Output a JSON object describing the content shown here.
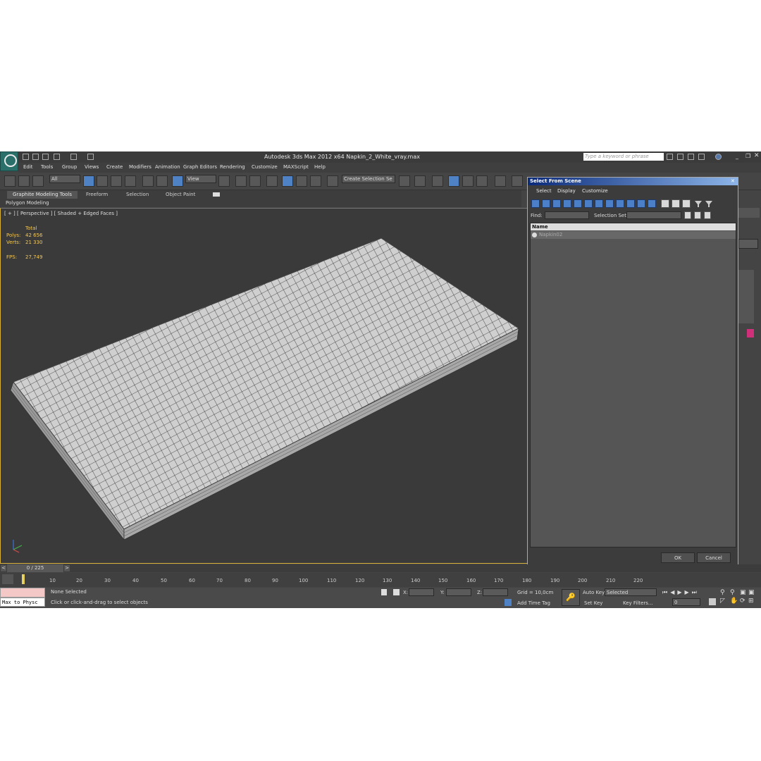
{
  "title": "Autodesk 3ds Max  2012 x64     Napkin_2_White_vray.max",
  "search_placeholder": "Type a keyword or phrase",
  "menu": [
    "Edit",
    "Tools",
    "Group",
    "Views",
    "Create",
    "Modifiers",
    "Animation",
    "Graph Editors",
    "Rendering",
    "Customize",
    "MAXScript",
    "Help"
  ],
  "toolbar": {
    "filter_combo": "All",
    "refcoord_combo": "View",
    "named_selection": "Create Selection Se"
  },
  "ribbon_tabs": [
    "Graphite Modeling Tools",
    "Freeform",
    "Selection",
    "Object Paint"
  ],
  "ribbon_sub": "Polygon Modeling",
  "viewport": {
    "label": "[ + ] [ Perspective ] [ Shaded + Edged Faces ]",
    "stats_header": "Total",
    "polys_label": "Polys:",
    "polys_value": "42 656",
    "verts_label": "Verts:",
    "verts_value": "21 330",
    "fps_label": "FPS:",
    "fps_value": "27,749"
  },
  "dialog": {
    "title": "Select From Scene",
    "menu": [
      "Select",
      "Display",
      "Customize"
    ],
    "find_label": "Find:",
    "selection_set_label": "Selection Set:",
    "column_name": "Name",
    "items": [
      "Napkin02"
    ],
    "ok": "OK",
    "cancel": "Cancel"
  },
  "timeslider": {
    "frame": "0 / 225"
  },
  "track_ticks": [
    "10",
    "20",
    "30",
    "40",
    "50",
    "60",
    "70",
    "80",
    "90",
    "100",
    "110",
    "120",
    "130",
    "140",
    "150",
    "160",
    "170",
    "180",
    "190",
    "200",
    "210",
    "220"
  ],
  "status": {
    "maxscript": "Max to Physc",
    "selection": "None Selected",
    "prompt": "Click or click-and-drag to select objects",
    "x_label": "X:",
    "y_label": "Y:",
    "z_label": "Z:",
    "grid": "Grid = 10,0cm",
    "add_time_tag": "Add Time Tag",
    "auto_key": "Auto Key",
    "set_key": "Set Key",
    "key_mode": "Selected",
    "key_filters": "Key Filters...",
    "current_frame": "0"
  },
  "colors": {
    "stats": "#f2c85a",
    "dialog_title": "#0a2a7a",
    "active_button": "#4e82c5",
    "viewport_border": "#d8b13a"
  }
}
